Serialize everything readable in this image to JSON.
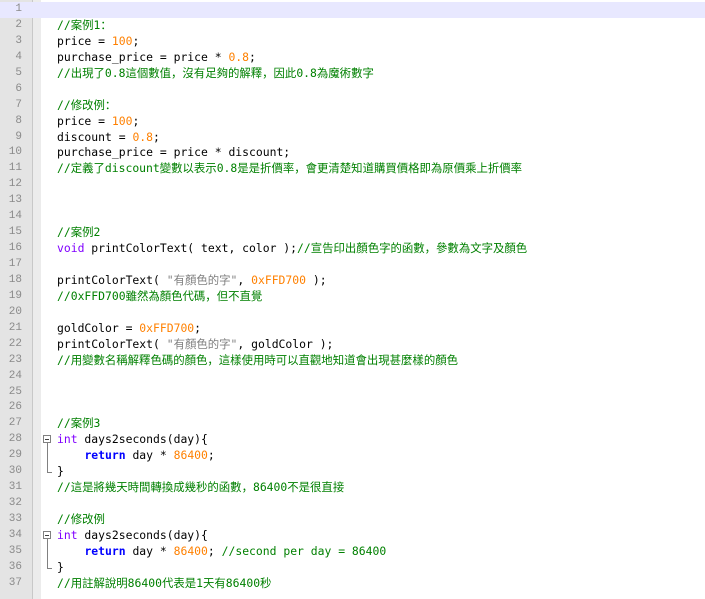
{
  "colors": {
    "comment": "#008000",
    "keyword": "#0000ff",
    "type": "#8000ff",
    "number": "#ff8000",
    "string": "#808080",
    "plain": "#000000",
    "current_line": "#e8e8ff",
    "gutter": "#e4e4e4"
  },
  "lines": [
    {
      "n": "1",
      "fold": "",
      "current": true,
      "tokens": []
    },
    {
      "n": "2",
      "fold": "",
      "tokens": [
        {
          "t": "//案例1：",
          "c": "comment"
        }
      ]
    },
    {
      "n": "3",
      "fold": "",
      "tokens": [
        {
          "t": "price = ",
          "c": "plain"
        },
        {
          "t": "100",
          "c": "number"
        },
        {
          "t": ";",
          "c": "plain"
        }
      ]
    },
    {
      "n": "4",
      "fold": "",
      "tokens": [
        {
          "t": "purchase_price = price * ",
          "c": "plain"
        },
        {
          "t": "0.8",
          "c": "number"
        },
        {
          "t": ";",
          "c": "plain"
        }
      ]
    },
    {
      "n": "5",
      "fold": "",
      "tokens": [
        {
          "t": "//出現了0.8這個數值，沒有足夠的解釋，因此0.8為魔術數字",
          "c": "comment"
        }
      ]
    },
    {
      "n": "6",
      "fold": "",
      "tokens": []
    },
    {
      "n": "7",
      "fold": "",
      "tokens": [
        {
          "t": "//修改例：",
          "c": "comment"
        }
      ]
    },
    {
      "n": "8",
      "fold": "",
      "tokens": [
        {
          "t": "price = ",
          "c": "plain"
        },
        {
          "t": "100",
          "c": "number"
        },
        {
          "t": ";",
          "c": "plain"
        }
      ]
    },
    {
      "n": "9",
      "fold": "",
      "tokens": [
        {
          "t": "discount = ",
          "c": "plain"
        },
        {
          "t": "0.8",
          "c": "number"
        },
        {
          "t": ";",
          "c": "plain"
        }
      ]
    },
    {
      "n": "10",
      "fold": "",
      "tokens": [
        {
          "t": "purchase_price = price * discount;",
          "c": "plain"
        }
      ]
    },
    {
      "n": "11",
      "fold": "",
      "tokens": [
        {
          "t": "//定義了discount變數以表示0.8是是折價率，會更清楚知道購買價格即為原價乘上折價率",
          "c": "comment"
        }
      ]
    },
    {
      "n": "12",
      "fold": "",
      "tokens": []
    },
    {
      "n": "13",
      "fold": "",
      "tokens": []
    },
    {
      "n": "14",
      "fold": "",
      "tokens": []
    },
    {
      "n": "15",
      "fold": "",
      "tokens": [
        {
          "t": "//案例2",
          "c": "comment"
        }
      ]
    },
    {
      "n": "16",
      "fold": "",
      "tokens": [
        {
          "t": "void",
          "c": "type"
        },
        {
          "t": " printColorText( text, color );",
          "c": "plain"
        },
        {
          "t": "//宣告印出顏色字的函數，參數為文字及顏色",
          "c": "comment"
        }
      ]
    },
    {
      "n": "17",
      "fold": "",
      "tokens": []
    },
    {
      "n": "18",
      "fold": "",
      "tokens": [
        {
          "t": "printColorText( ",
          "c": "plain"
        },
        {
          "t": "\"有顏色的字\"",
          "c": "string"
        },
        {
          "t": ", ",
          "c": "plain"
        },
        {
          "t": "0xFFD700",
          "c": "number"
        },
        {
          "t": " );",
          "c": "plain"
        }
      ]
    },
    {
      "n": "19",
      "fold": "",
      "tokens": [
        {
          "t": "//0xFFD700雖然為顏色代碼，但不直覺",
          "c": "comment"
        }
      ]
    },
    {
      "n": "20",
      "fold": "",
      "tokens": []
    },
    {
      "n": "21",
      "fold": "",
      "tokens": [
        {
          "t": "goldColor = ",
          "c": "plain"
        },
        {
          "t": "0xFFD700",
          "c": "number"
        },
        {
          "t": ";",
          "c": "plain"
        }
      ]
    },
    {
      "n": "22",
      "fold": "",
      "tokens": [
        {
          "t": "printColorText( ",
          "c": "plain"
        },
        {
          "t": "\"有顏色的字\"",
          "c": "string"
        },
        {
          "t": ", goldColor );",
          "c": "plain"
        }
      ]
    },
    {
      "n": "23",
      "fold": "",
      "tokens": [
        {
          "t": "//用變數名稱解釋色碼的顏色，這樣使用時可以直觀地知道會出現甚麼樣的顏色",
          "c": "comment"
        }
      ]
    },
    {
      "n": "24",
      "fold": "",
      "tokens": []
    },
    {
      "n": "25",
      "fold": "",
      "tokens": []
    },
    {
      "n": "26",
      "fold": "",
      "tokens": []
    },
    {
      "n": "27",
      "fold": "",
      "tokens": [
        {
          "t": "//案例3",
          "c": "comment"
        }
      ]
    },
    {
      "n": "28",
      "fold": "open",
      "tokens": [
        {
          "t": "int",
          "c": "type"
        },
        {
          "t": " days2seconds(day){",
          "c": "plain"
        }
      ]
    },
    {
      "n": "29",
      "fold": "line",
      "tokens": [
        {
          "t": "    ",
          "c": "plain"
        },
        {
          "t": "return",
          "c": "keyword-bold"
        },
        {
          "t": " day * ",
          "c": "plain"
        },
        {
          "t": "86400",
          "c": "number"
        },
        {
          "t": ";",
          "c": "plain"
        }
      ]
    },
    {
      "n": "30",
      "fold": "end",
      "tokens": [
        {
          "t": "}",
          "c": "plain"
        }
      ]
    },
    {
      "n": "31",
      "fold": "",
      "tokens": [
        {
          "t": "//這是將幾天時間轉換成幾秒的函數，86400不是很直接",
          "c": "comment"
        }
      ]
    },
    {
      "n": "32",
      "fold": "",
      "tokens": []
    },
    {
      "n": "33",
      "fold": "",
      "tokens": [
        {
          "t": "//修改例",
          "c": "comment"
        }
      ]
    },
    {
      "n": "34",
      "fold": "open",
      "tokens": [
        {
          "t": "int",
          "c": "type"
        },
        {
          "t": " days2seconds(day){",
          "c": "plain"
        }
      ]
    },
    {
      "n": "35",
      "fold": "line",
      "tokens": [
        {
          "t": "    ",
          "c": "plain"
        },
        {
          "t": "return",
          "c": "keyword-bold"
        },
        {
          "t": " day * ",
          "c": "plain"
        },
        {
          "t": "86400",
          "c": "number"
        },
        {
          "t": "; ",
          "c": "plain"
        },
        {
          "t": "//second per day = 86400",
          "c": "comment"
        }
      ]
    },
    {
      "n": "36",
      "fold": "end",
      "tokens": [
        {
          "t": "}",
          "c": "plain"
        }
      ]
    },
    {
      "n": "37",
      "fold": "",
      "tokens": [
        {
          "t": "//用註解說明86400代表是1天有86400秒",
          "c": "comment"
        }
      ]
    }
  ]
}
